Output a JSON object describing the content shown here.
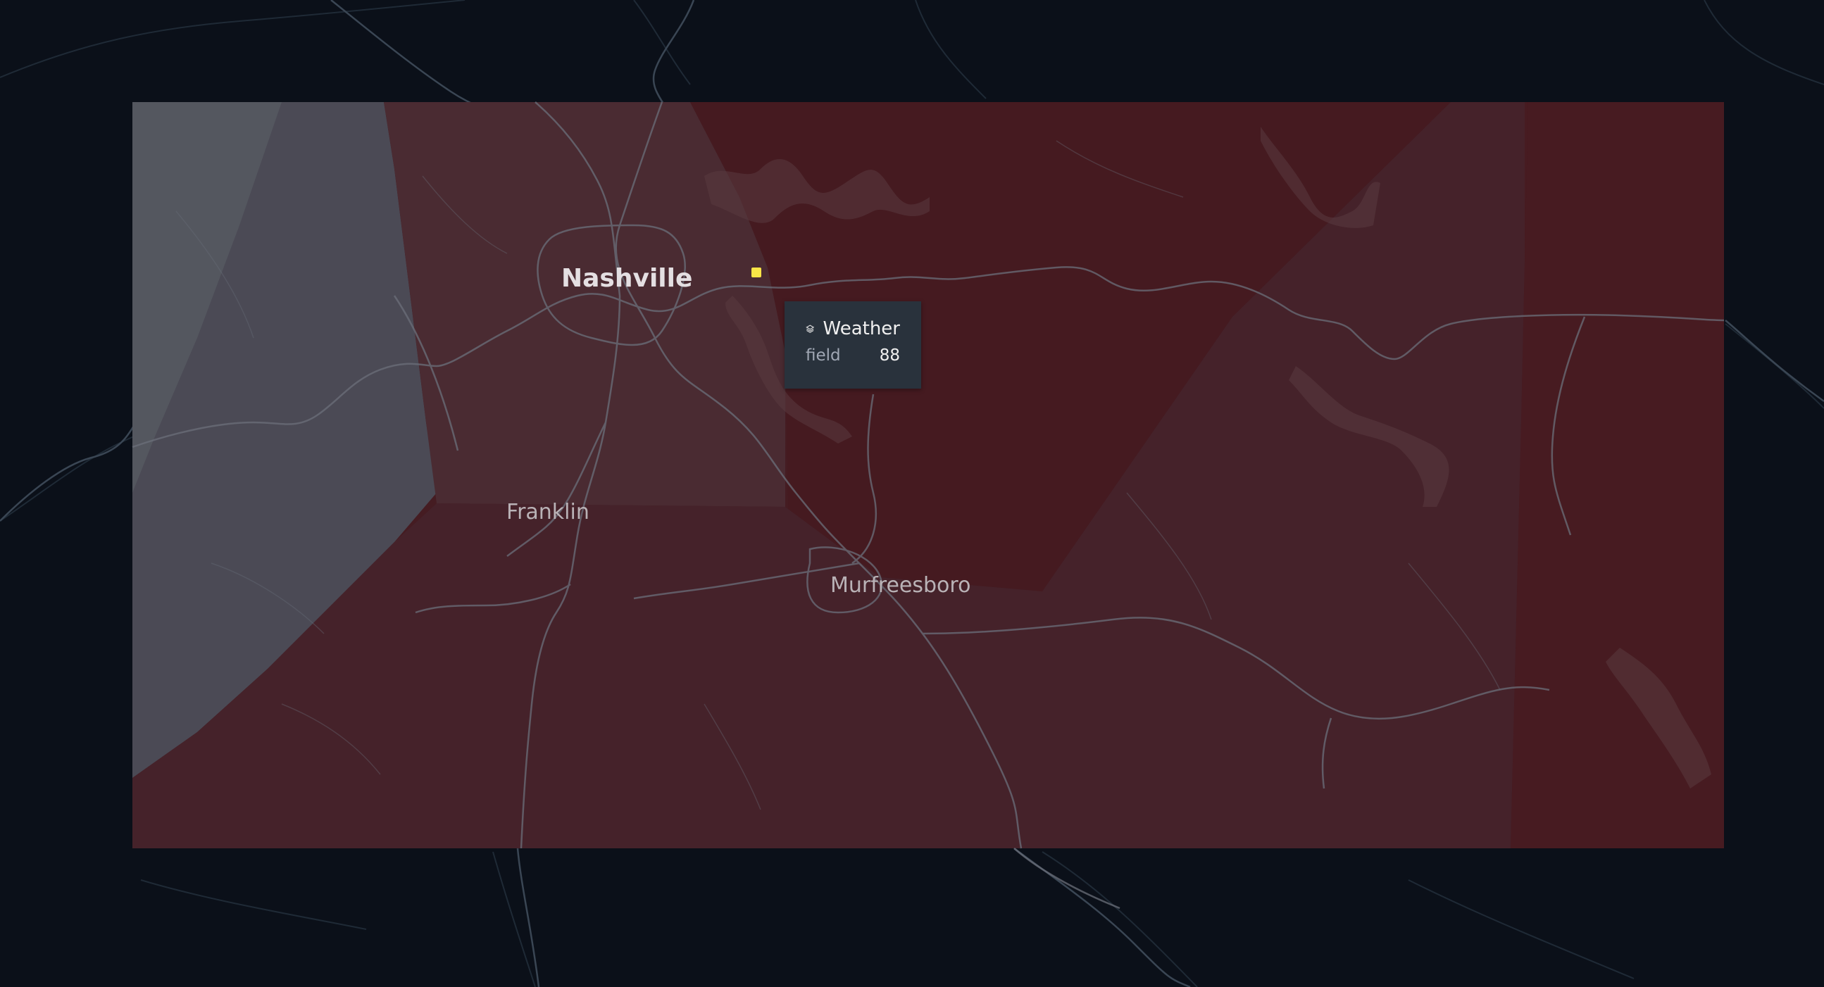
{
  "map": {
    "cities": [
      {
        "id": "nashville",
        "name": "Nashville",
        "major": true
      },
      {
        "id": "franklin",
        "name": "Franklin",
        "major": false
      },
      {
        "id": "murfreesboro",
        "name": "Murfreesboro",
        "major": false
      }
    ]
  },
  "tooltip": {
    "layer_icon": "layers-icon",
    "layer_name": "Weather",
    "field_key": "field",
    "field_value": "88"
  },
  "colors": {
    "background": "#0b1019",
    "road": "#5a6470",
    "water": "#3a2a30",
    "region_high": "#4a1a20",
    "region_mid": "#42242a",
    "region_low": "#52505c",
    "marker": "#f9e547",
    "tooltip_bg": "#29323c"
  }
}
